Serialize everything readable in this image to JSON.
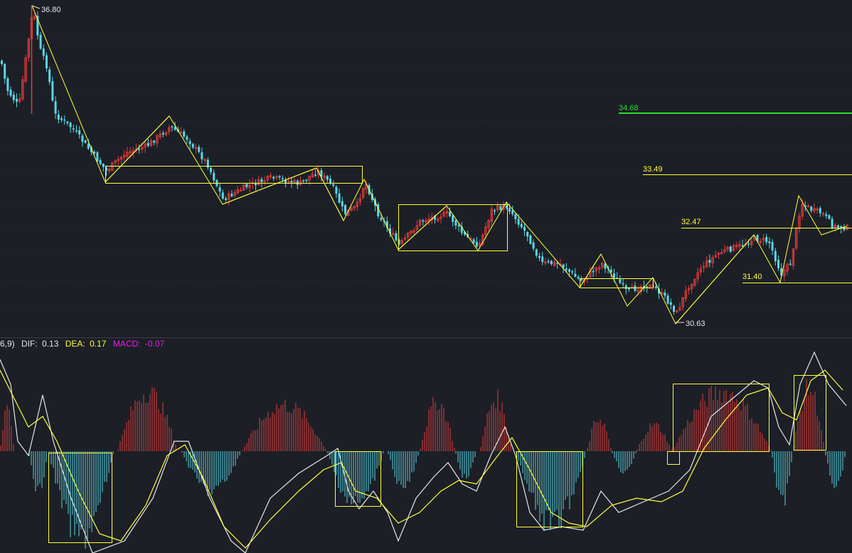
{
  "chart_data": [
    {
      "type": "candlestick",
      "colors": {
        "up": "#e03c3c",
        "down": "#5ad7e6",
        "zigzag": "#ffff3c",
        "green_level": "#28dc28",
        "background": "#1c1f26"
      },
      "extremes": {
        "high": "36.80",
        "low": "30.63"
      },
      "level_labels": [
        {
          "key": "l1",
          "value": "34.68",
          "color": "#28dc28"
        },
        {
          "key": "l2",
          "value": "33.49",
          "color": "#ffff3c"
        },
        {
          "key": "l3",
          "value": "32.47",
          "color": "#ffff3c"
        },
        {
          "key": "l4",
          "value": "31.40",
          "color": "#ffff3c"
        }
      ]
    },
    {
      "type": "macd",
      "header_prefix": "6,9)",
      "indicators": [
        {
          "name": "DIF:",
          "value": "0.13",
          "color": "#e6e6e6"
        },
        {
          "name": "DEA:",
          "value": "0.17",
          "color": "#ffff3c"
        },
        {
          "name": "MACD:",
          "value": "-0.07",
          "color": "#e61ee6"
        }
      ]
    }
  ]
}
